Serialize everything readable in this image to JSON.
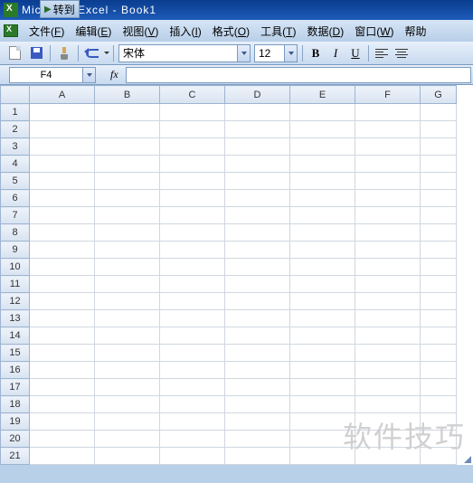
{
  "top_fragment": "转到",
  "title": "Microsoft Excel - Book1",
  "menus": {
    "file": {
      "label": "文件",
      "key": "F"
    },
    "edit": {
      "label": "编辑",
      "key": "E"
    },
    "view": {
      "label": "视图",
      "key": "V"
    },
    "insert": {
      "label": "插入",
      "key": "I"
    },
    "format": {
      "label": "格式",
      "key": "O"
    },
    "tools": {
      "label": "工具",
      "key": "T"
    },
    "data": {
      "label": "数据",
      "key": "D"
    },
    "window": {
      "label": "窗口",
      "key": "W"
    },
    "help": {
      "label": "帮助"
    }
  },
  "toolbar": {
    "font_name": "宋体",
    "font_size": "12",
    "bold": "B",
    "italic": "I",
    "underline": "U"
  },
  "namebox": "F4",
  "fx": "fx",
  "columns": [
    "A",
    "B",
    "C",
    "D",
    "E",
    "F",
    "G"
  ],
  "rows": [
    "1",
    "2",
    "3",
    "4",
    "5",
    "6",
    "7",
    "8",
    "9",
    "10",
    "11",
    "12",
    "13",
    "14",
    "15",
    "16",
    "17",
    "18",
    "19",
    "20",
    "21"
  ],
  "watermark": "软件技巧",
  "chart_data": {
    "type": "table",
    "columns": [
      "A",
      "B",
      "C",
      "D",
      "E",
      "F",
      "G"
    ],
    "rows": 21,
    "cells": {}
  }
}
